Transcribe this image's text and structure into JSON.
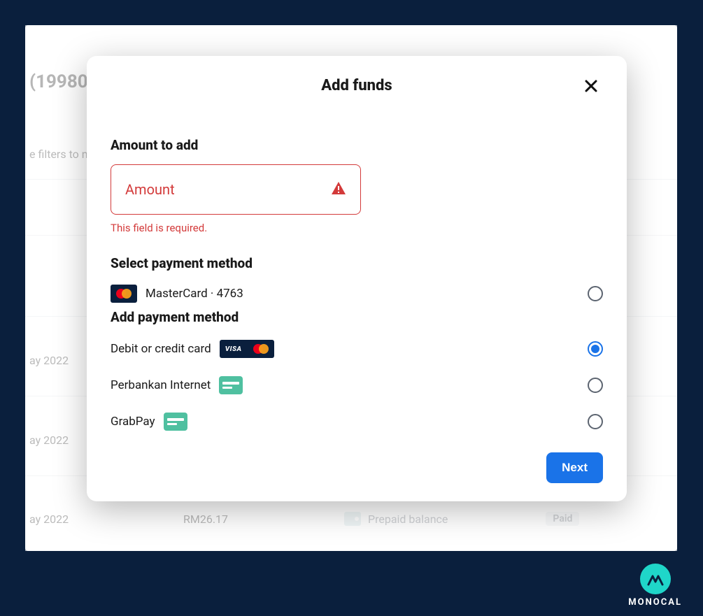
{
  "background": {
    "heading_fragment": "(19980",
    "filters_fragment": "e filters to n",
    "rows": [
      {
        "date_fragment": "ay 2022"
      },
      {
        "date_fragment": "ay 2022"
      },
      {
        "date_fragment": "ay 2022",
        "amount": "RM26.17",
        "method": "Prepaid balance",
        "status": "Paid"
      }
    ]
  },
  "modal": {
    "title": "Add funds",
    "amount_section": {
      "label": "Amount to add",
      "placeholder": "Amount",
      "error": "This field is required."
    },
    "select_label": "Select payment method",
    "saved_methods": [
      {
        "label": "MasterCard · 4763",
        "selected": false,
        "icon": "mastercard"
      }
    ],
    "add_method_label": "Add payment method",
    "add_methods": [
      {
        "label": "Debit or credit card",
        "selected": true,
        "icon": "visa-mastercard"
      },
      {
        "label": "Perbankan Internet",
        "selected": false,
        "icon": "bank-card"
      },
      {
        "label": "GrabPay",
        "selected": false,
        "icon": "bank-card"
      }
    ],
    "next_label": "Next"
  },
  "brand": {
    "name": "MONOCAL"
  }
}
